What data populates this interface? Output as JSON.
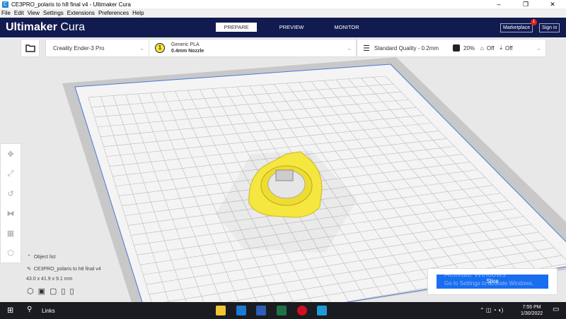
{
  "window": {
    "title": "CE3PRO_polaris to h8 final v4 - Ultimaker Cura",
    "minimize": "–",
    "restore": "❐",
    "close": "✕"
  },
  "menu": [
    "File",
    "Edit",
    "View",
    "Settings",
    "Extensions",
    "Preferences",
    "Help"
  ],
  "header": {
    "logo_bold": "Ultimaker",
    "logo_light": " Cura",
    "tabs": [
      "PREPARE",
      "PREVIEW",
      "MONITOR"
    ],
    "marketplace": "Marketplace",
    "marketplace_badge": "1",
    "signin": "Sign in"
  },
  "toolbar": {
    "printer": "Creality Ender-3 Pro",
    "extruder_number": "1",
    "material": "Generic PLA",
    "nozzle": "0.4mm Nozzle",
    "quality": "Standard Quality - 0.2mm",
    "infill": "20%",
    "support": "Off",
    "adhesion": "Off"
  },
  "object": {
    "list_label": "Object list",
    "name": "CE3PRO_polaris to h8 final v4",
    "dimensions": "43.0 x 41.9 x 9.1 mm"
  },
  "slice": {
    "label": "Slice"
  },
  "watermark": {
    "line1": "Activate Windows",
    "line2": "Go to Settings to activate Windows."
  },
  "taskbar": {
    "search": "Links",
    "time": "7:55 PM",
    "date": "1/30/2022"
  },
  "colors": {
    "header": "#111b50",
    "slice": "#196ef0",
    "object": "#f5e640"
  }
}
